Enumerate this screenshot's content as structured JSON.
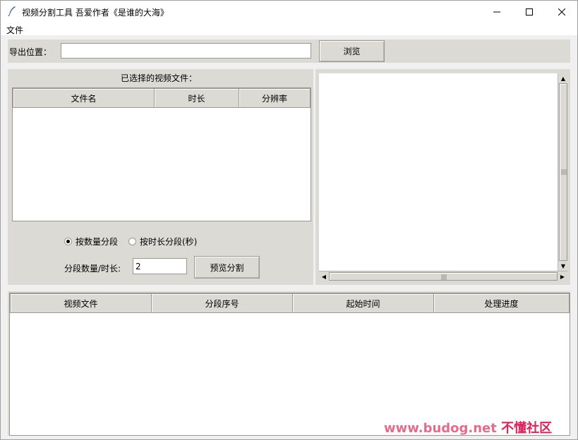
{
  "window": {
    "title": "视频分割工具 吾爱作者《是谁的大海》"
  },
  "menu": {
    "file": "文件"
  },
  "export": {
    "label": "导出位置：",
    "value": "",
    "browse_label": "浏览"
  },
  "selected_files": {
    "label": "已选择的视频文件：",
    "columns": [
      "文件名",
      "时长",
      "分辨率"
    ]
  },
  "split_mode": {
    "options": [
      "按数量分段",
      "按时长分段(秒)"
    ],
    "selected": "按数量分段"
  },
  "segment": {
    "label": "分段数量/时长:",
    "value": "2",
    "preview_label": "预览分割"
  },
  "results": {
    "columns": [
      "视频文件",
      "分段序号",
      "起始时间",
      "处理进度"
    ]
  },
  "watermark": {
    "url": "www.budog.net",
    "site": "不懂社区"
  },
  "icons": {
    "app": "feather-icon",
    "minimize": "minimize-icon",
    "maximize": "maximize-icon",
    "close": "close-icon"
  }
}
